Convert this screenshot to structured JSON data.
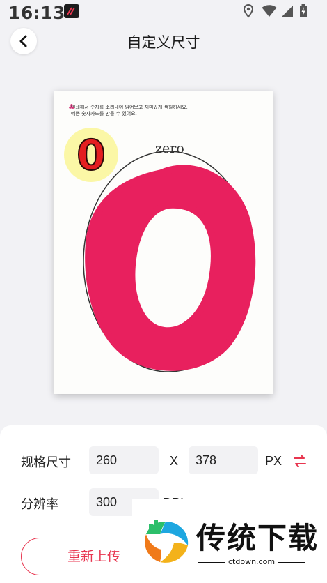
{
  "status_bar": {
    "time": "16:13",
    "icons": [
      "app-notification-icon",
      "location-icon",
      "wifi-icon",
      "signal-icon",
      "battery-charging-icon"
    ]
  },
  "header": {
    "title": "自定义尺寸",
    "back_icon": "chevron-left-icon"
  },
  "preview": {
    "worksheet_instruction_line1": "인쇄해서 숫자를 소리내어 읽어보고 재미있게 색칠하세요.",
    "worksheet_instruction_line2": "예쁜 숫자카드를 만들 수 있어요.",
    "worksheet_word": "zero",
    "worksheet_badge_digit": "0",
    "drawing_color": "#e8205e",
    "badge_color": "#fbf7a6"
  },
  "settings": {
    "size_label": "规格尺寸",
    "width_value": "260",
    "separator": "X",
    "height_value": "378",
    "size_unit": "PX",
    "swap_icon": "swap-arrows-icon",
    "resolution_label": "分辨率",
    "resolution_value": "300",
    "resolution_unit": "DPI"
  },
  "actions": {
    "reupload_label": "重新上传"
  },
  "watermark": {
    "title": "传统下载",
    "url": "ctdown.com"
  },
  "colors": {
    "accent": "#e8354f",
    "background": "#f2f2f5",
    "input_bg": "#f2f2f4"
  }
}
